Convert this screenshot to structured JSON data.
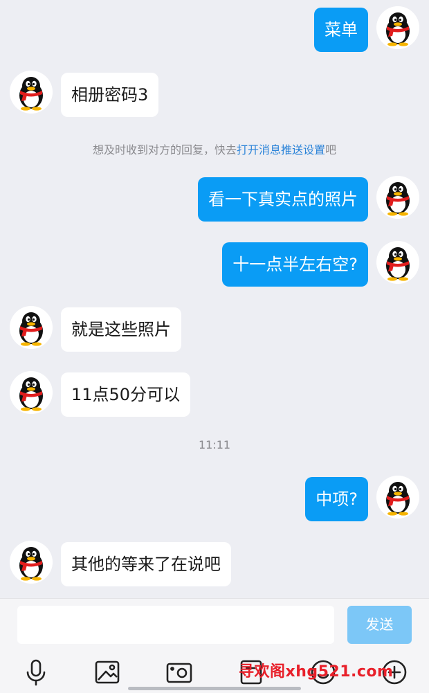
{
  "messages": [
    {
      "side": "me",
      "text": "菜单"
    },
    {
      "side": "them",
      "text": "相册密码3"
    },
    {
      "side": "me",
      "text": "看一下真实点的照片"
    },
    {
      "side": "me",
      "text": "十一点半左右空?"
    },
    {
      "side": "them",
      "text": "就是这些照片"
    },
    {
      "side": "them",
      "text": "11点50分可以"
    },
    {
      "side": "me",
      "text": "中项?"
    },
    {
      "side": "them",
      "text": "其他的等来了在说吧"
    }
  ],
  "notice": {
    "prefix": "想及时收到对方的回复，快去",
    "link": "打开消息推送设置",
    "suffix": "吧"
  },
  "timestamp": "11:11",
  "composer": {
    "placeholder": "",
    "send_label": "发送"
  },
  "toolbar": [
    "microphone-icon",
    "image-icon",
    "camera-icon",
    "file-icon",
    "emoji-icon",
    "more-icon"
  ],
  "watermark": "寻欢阁xhg521.com"
}
